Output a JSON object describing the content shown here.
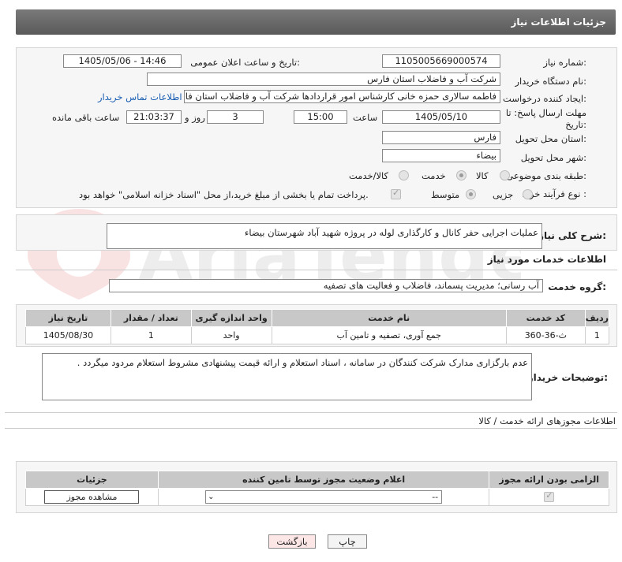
{
  "header": {
    "title": "جزئیات اطلاعات نیاز"
  },
  "form": {
    "need_number_label": "شماره نیاز:",
    "need_number": "1105005669000574",
    "announce_label": "تاریخ و ساعت اعلان عمومی:",
    "announce_value": "1405/05/06 - 14:46",
    "buyer_org_label": "نام دستگاه خریدار:",
    "buyer_org": "شرکت آب و فاضلاب استان فارس",
    "creator_label": "ایجاد کننده درخواست:",
    "creator": "فاطمه سالاری حمزه خانی کارشناس امور قراردادها شرکت آب و فاضلاب استان فارس",
    "contact_link": "اطلاعات تماس خریدار",
    "deadline_label_1": "مهلت ارسال پاسخ: تا",
    "deadline_label_2": "تاریخ:",
    "deadline_date": "1405/05/10",
    "time_label": "ساعت",
    "deadline_time": "15:00",
    "days": "3",
    "days_label": "روز و",
    "remaining": "21:03:37",
    "remaining_label": "ساعت باقی مانده",
    "province_label": "استان محل تحویل:",
    "province": "فارس",
    "city_label": "شهر محل تحویل:",
    "city": "بیضاء",
    "category_label": "طبقه بندی موضوعی:",
    "cat_goods": "کالا",
    "cat_service": "خدمت",
    "cat_goods_service": "کالا/خدمت",
    "process_label": "نوع فرآیند خرید :",
    "proc_partial": "جزیی",
    "proc_medium": "متوسط",
    "payment_note": "پرداخت تمام یا بخشی از مبلغ خرید،از محل \"اسناد خزانه اسلامی\" خواهد بود."
  },
  "description": {
    "label": "شرح کلی نیاز:",
    "text": "عملیات اجرایی حفر کانال و کارگذاری لوله در پروژه شهید آباد شهرستان بیضاء"
  },
  "services": {
    "section_title": "اطلاعات خدمات مورد نیاز",
    "group_label": "گروه خدمت:",
    "group_value": "آب رسانی؛ مدیریت پسماند، فاضلاب و فعالیت های تصفیه",
    "columns": [
      "ردیف",
      "کد خدمت",
      "نام خدمت",
      "واحد اندازه گیری",
      "تعداد / مقدار",
      "تاریخ نیاز"
    ],
    "rows": [
      [
        "1",
        "ث-36-360",
        "جمع آوری، تصفیه و تامین آب",
        "واحد",
        "1",
        "1405/08/30"
      ]
    ]
  },
  "buyer_notes": {
    "label": "توضیحات خریدار:",
    "text": "عدم بارگزاری مدارک شرکت کنندگان در سامانه ، اسناد استعلام و ارائه قیمت پیشنهادی مشروط استعلام مردود میگردد ."
  },
  "permits": {
    "section_title": "اطلاعات مجوزهای ارائه خدمت / کالا",
    "columns": [
      "الزامی بودن ارائه مجوز",
      "اعلام وضعیت مجوز توسط تامین کننده",
      "جزئیات"
    ],
    "select_value": "--",
    "view_button": "مشاهده مجوز"
  },
  "actions": {
    "print": "چاپ",
    "back": "بازگشت"
  },
  "watermark": {
    "text": "AriaTender.net"
  }
}
